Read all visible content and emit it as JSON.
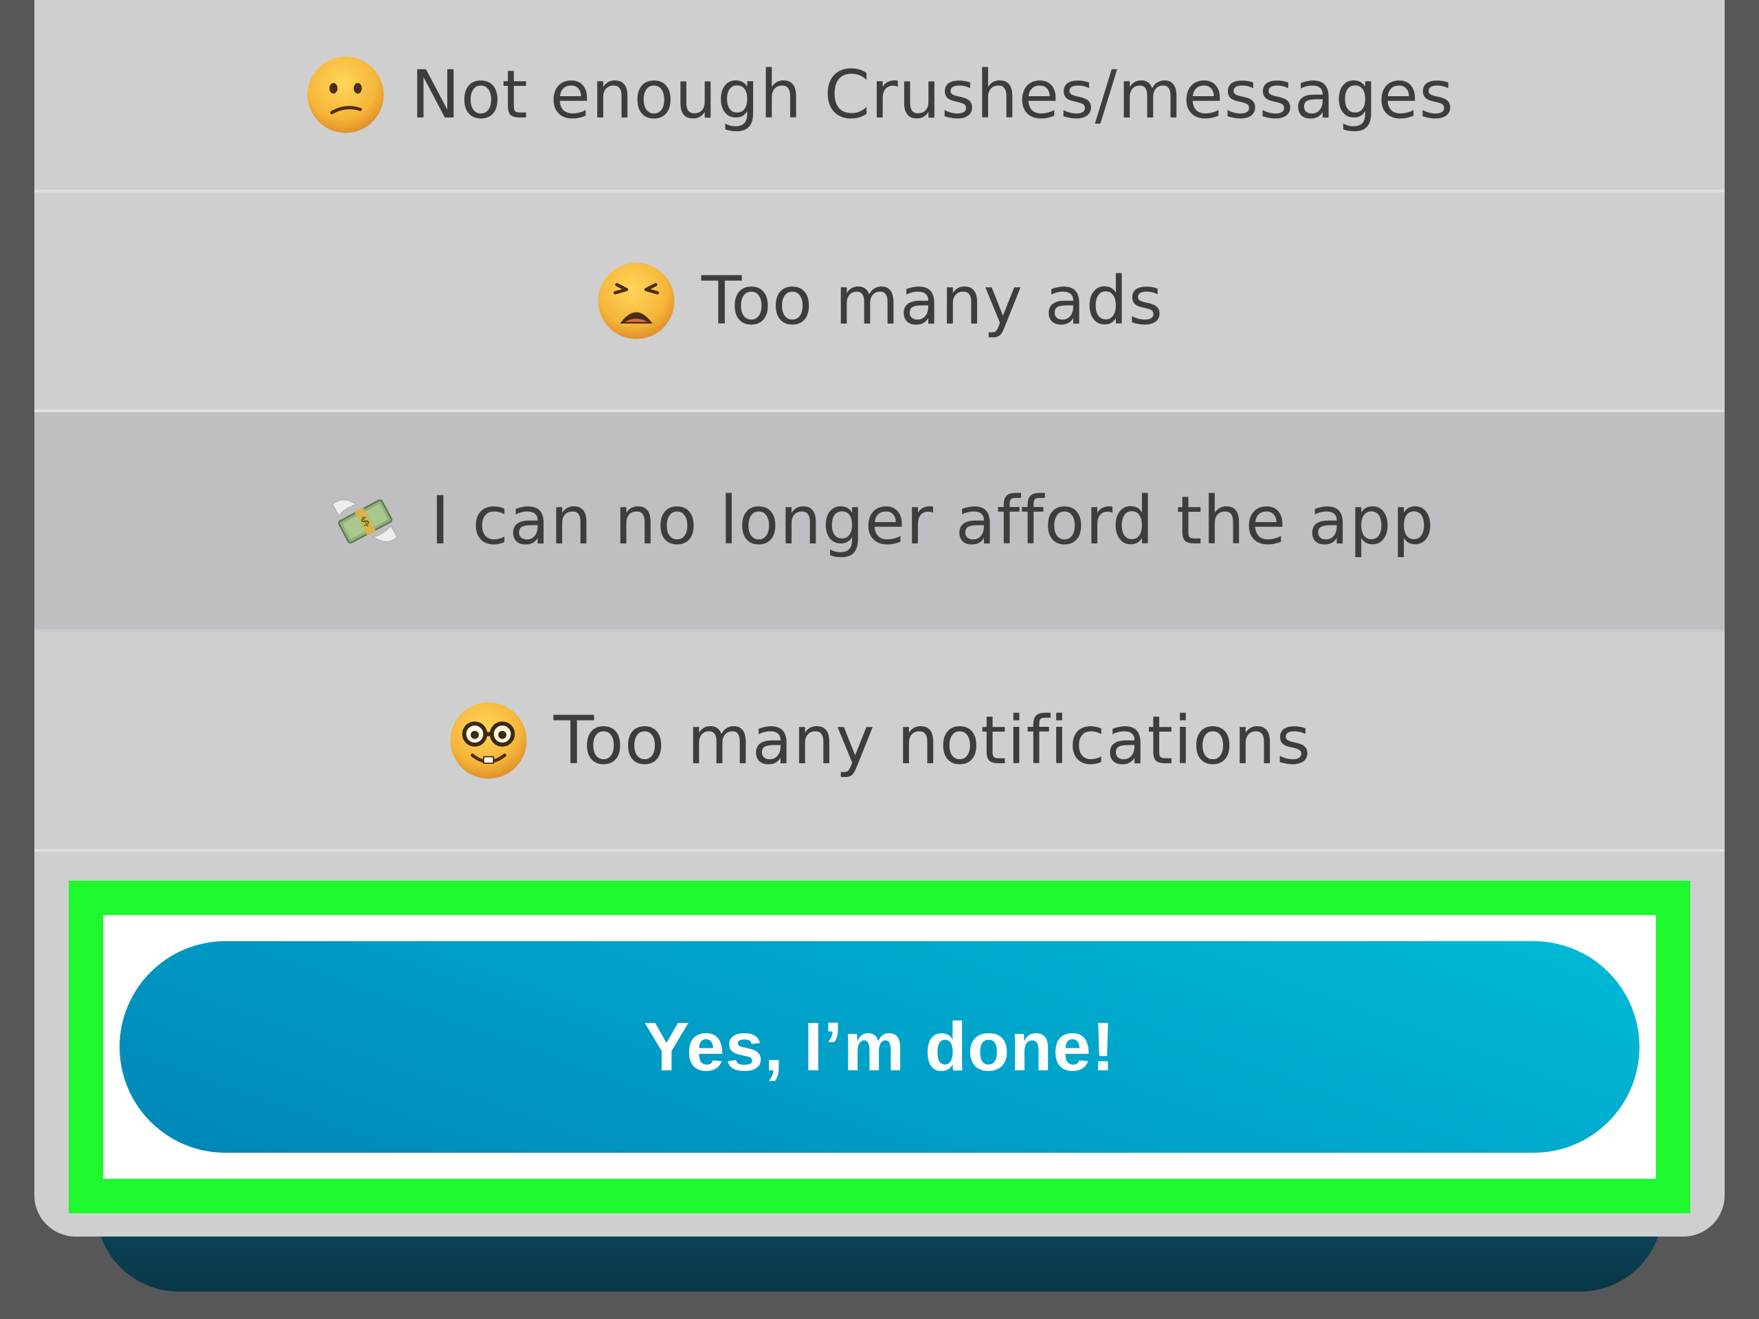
{
  "options": [
    {
      "emoji": "confused-face-icon",
      "label": "Not enough Crushes/messages"
    },
    {
      "emoji": "weary-face-icon",
      "label": "Too many ads"
    },
    {
      "emoji": "money-with-wings-icon",
      "label": "I can no longer afford the app"
    },
    {
      "emoji": "nerd-face-icon",
      "label": "Too many notifications"
    }
  ],
  "selected_option_index": 2,
  "confirm": {
    "label": "Yes, I’m done!"
  },
  "colors": {
    "highlight_border": "#1ef92d",
    "button_gradient_start": "#00bad6",
    "button_gradient_end": "#0086b6",
    "sheet_background": "#cfcfcf",
    "selected_row": "#bebec3"
  }
}
